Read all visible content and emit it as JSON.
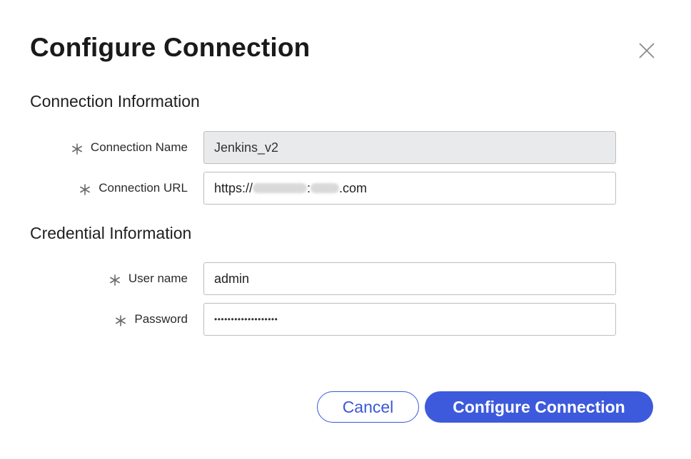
{
  "dialog": {
    "title": "Configure Connection",
    "close_icon": "close-icon"
  },
  "sections": {
    "connection": {
      "title": "Connection Information",
      "name_label": "Connection Name",
      "name_value": "Jenkins_v2",
      "url_label": "Connection URL",
      "url_prefix": "https://",
      "url_separator": ":",
      "url_suffix": ".com",
      "url_redacted_note": "blurred"
    },
    "credential": {
      "title": "Credential Information",
      "username_label": "User name",
      "username_value": "admin",
      "password_label": "Password",
      "password_value": "•••••••••••••••••••"
    }
  },
  "buttons": {
    "cancel": "Cancel",
    "configure": "Configure Connection"
  },
  "colors": {
    "primary": "#3d5adc",
    "disabled_field_bg": "#e9eaec",
    "border": "#bdbdbd"
  },
  "icons": {
    "required": "asterisk-icon",
    "close": "close-icon"
  }
}
